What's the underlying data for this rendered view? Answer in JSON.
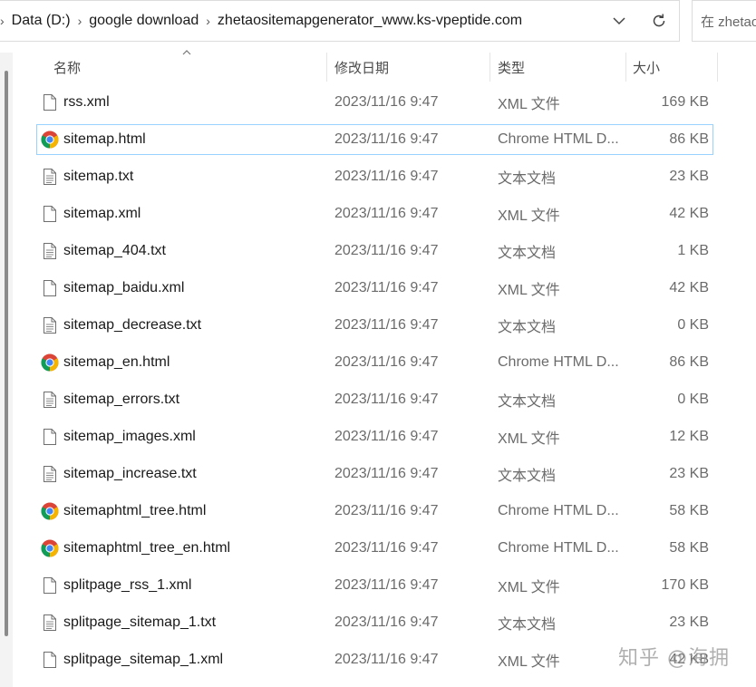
{
  "address": {
    "breadcrumbs": [
      "Data (D:)",
      "google download",
      "zhetaositemapgenerator_www.ks-vpeptide.com"
    ],
    "dropdown_icon": "chevron-down-icon",
    "refresh_icon": "refresh-icon"
  },
  "search": {
    "placeholder": "在 zhetao"
  },
  "columns": {
    "name": "名称",
    "date": "修改日期",
    "type": "类型",
    "size": "大小"
  },
  "files": [
    {
      "name": "rss.xml",
      "date": "2023/11/16 9:47",
      "type": "XML 文件",
      "size": "169 KB",
      "icon": "document-icon"
    },
    {
      "name": "sitemap.html",
      "date": "2023/11/16 9:47",
      "type": "Chrome HTML D...",
      "size": "86 KB",
      "icon": "chrome-icon"
    },
    {
      "name": "sitemap.txt",
      "date": "2023/11/16 9:47",
      "type": "文本文档",
      "size": "23 KB",
      "icon": "text-file-icon"
    },
    {
      "name": "sitemap.xml",
      "date": "2023/11/16 9:47",
      "type": "XML 文件",
      "size": "42 KB",
      "icon": "document-icon"
    },
    {
      "name": "sitemap_404.txt",
      "date": "2023/11/16 9:47",
      "type": "文本文档",
      "size": "1 KB",
      "icon": "text-file-icon"
    },
    {
      "name": "sitemap_baidu.xml",
      "date": "2023/11/16 9:47",
      "type": "XML 文件",
      "size": "42 KB",
      "icon": "document-icon"
    },
    {
      "name": "sitemap_decrease.txt",
      "date": "2023/11/16 9:47",
      "type": "文本文档",
      "size": "0 KB",
      "icon": "text-file-icon"
    },
    {
      "name": "sitemap_en.html",
      "date": "2023/11/16 9:47",
      "type": "Chrome HTML D...",
      "size": "86 KB",
      "icon": "chrome-icon"
    },
    {
      "name": "sitemap_errors.txt",
      "date": "2023/11/16 9:47",
      "type": "文本文档",
      "size": "0 KB",
      "icon": "text-file-icon"
    },
    {
      "name": "sitemap_images.xml",
      "date": "2023/11/16 9:47",
      "type": "XML 文件",
      "size": "12 KB",
      "icon": "document-icon"
    },
    {
      "name": "sitemap_increase.txt",
      "date": "2023/11/16 9:47",
      "type": "文本文档",
      "size": "23 KB",
      "icon": "text-file-icon"
    },
    {
      "name": "sitemaphtml_tree.html",
      "date": "2023/11/16 9:47",
      "type": "Chrome HTML D...",
      "size": "58 KB",
      "icon": "chrome-icon"
    },
    {
      "name": "sitemaphtml_tree_en.html",
      "date": "2023/11/16 9:47",
      "type": "Chrome HTML D...",
      "size": "58 KB",
      "icon": "chrome-icon"
    },
    {
      "name": "splitpage_rss_1.xml",
      "date": "2023/11/16 9:47",
      "type": "XML 文件",
      "size": "170 KB",
      "icon": "document-icon"
    },
    {
      "name": "splitpage_sitemap_1.txt",
      "date": "2023/11/16 9:47",
      "type": "文本文档",
      "size": "23 KB",
      "icon": "text-file-icon"
    },
    {
      "name": "splitpage_sitemap_1.xml",
      "date": "2023/11/16 9:47",
      "type": "XML 文件",
      "size": "42 KB",
      "icon": "document-icon"
    }
  ],
  "selected_file": "sitemap.html",
  "watermark": "知乎 @海拥"
}
